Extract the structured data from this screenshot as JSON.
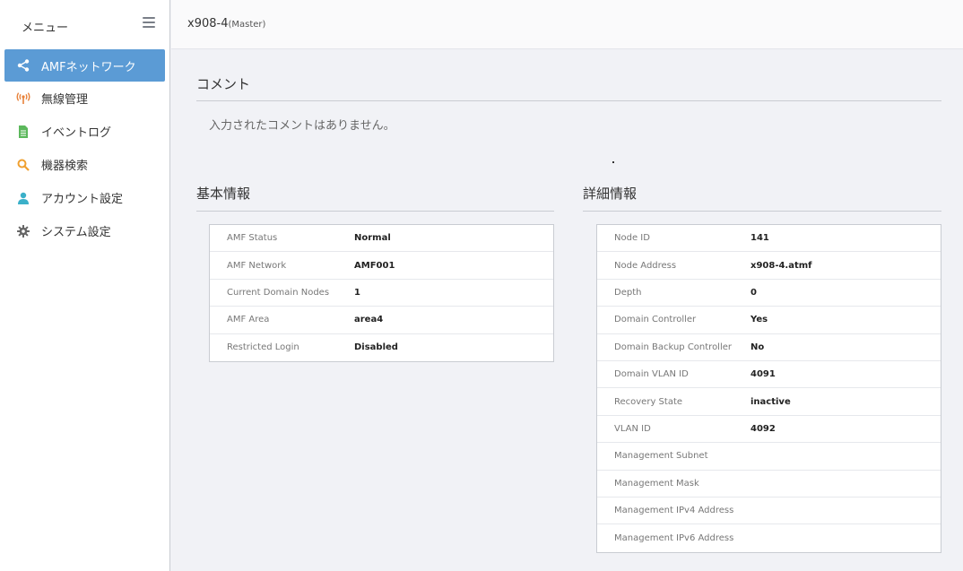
{
  "sidebar": {
    "title": "メニュー",
    "items": [
      {
        "label": "AMFネットワーク",
        "icon": "share-icon",
        "active": true,
        "color": "#ffffff"
      },
      {
        "label": "無線管理",
        "icon": "wireless-icon",
        "color": "#e8823a"
      },
      {
        "label": "イベントログ",
        "icon": "document-icon",
        "color": "#5cb85c"
      },
      {
        "label": "機器検索",
        "icon": "search-icon",
        "color": "#f0a030"
      },
      {
        "label": "アカウント設定",
        "icon": "user-icon",
        "color": "#3bb0c9"
      },
      {
        "label": "システム設定",
        "icon": "gear-icon",
        "color": "#666666"
      }
    ]
  },
  "header": {
    "device_name": "x908-4",
    "device_role": "(Master)"
  },
  "comment": {
    "title": "コメント",
    "text": "入力されたコメントはありません。"
  },
  "basic_info": {
    "title": "基本情報",
    "rows": [
      {
        "label": "AMF Status",
        "value": "Normal"
      },
      {
        "label": "AMF Network",
        "value": "AMF001"
      },
      {
        "label": "Current Domain Nodes",
        "value": "1"
      },
      {
        "label": "AMF Area",
        "value": "area4"
      },
      {
        "label": "Restricted Login",
        "value": "Disabled"
      }
    ]
  },
  "detail_info": {
    "title": "詳細情報",
    "rows": [
      {
        "label": "Node ID",
        "value": "141"
      },
      {
        "label": "Node Address",
        "value": "x908-4.atmf"
      },
      {
        "label": "Depth",
        "value": "0"
      },
      {
        "label": "Domain Controller",
        "value": "Yes"
      },
      {
        "label": "Domain Backup Controller",
        "value": "No"
      },
      {
        "label": "Domain VLAN ID",
        "value": "4091"
      },
      {
        "label": "Recovery State",
        "value": "inactive"
      },
      {
        "label": "VLAN ID",
        "value": "4092"
      },
      {
        "label": "Management Subnet",
        "value": "",
        "blurred": true
      },
      {
        "label": "Management Mask",
        "value": "",
        "blurred": true
      },
      {
        "label": "Management IPv4 Address",
        "value": "",
        "blurred": true
      },
      {
        "label": "Management IPv6 Address",
        "value": "",
        "blurred": true
      }
    ]
  }
}
